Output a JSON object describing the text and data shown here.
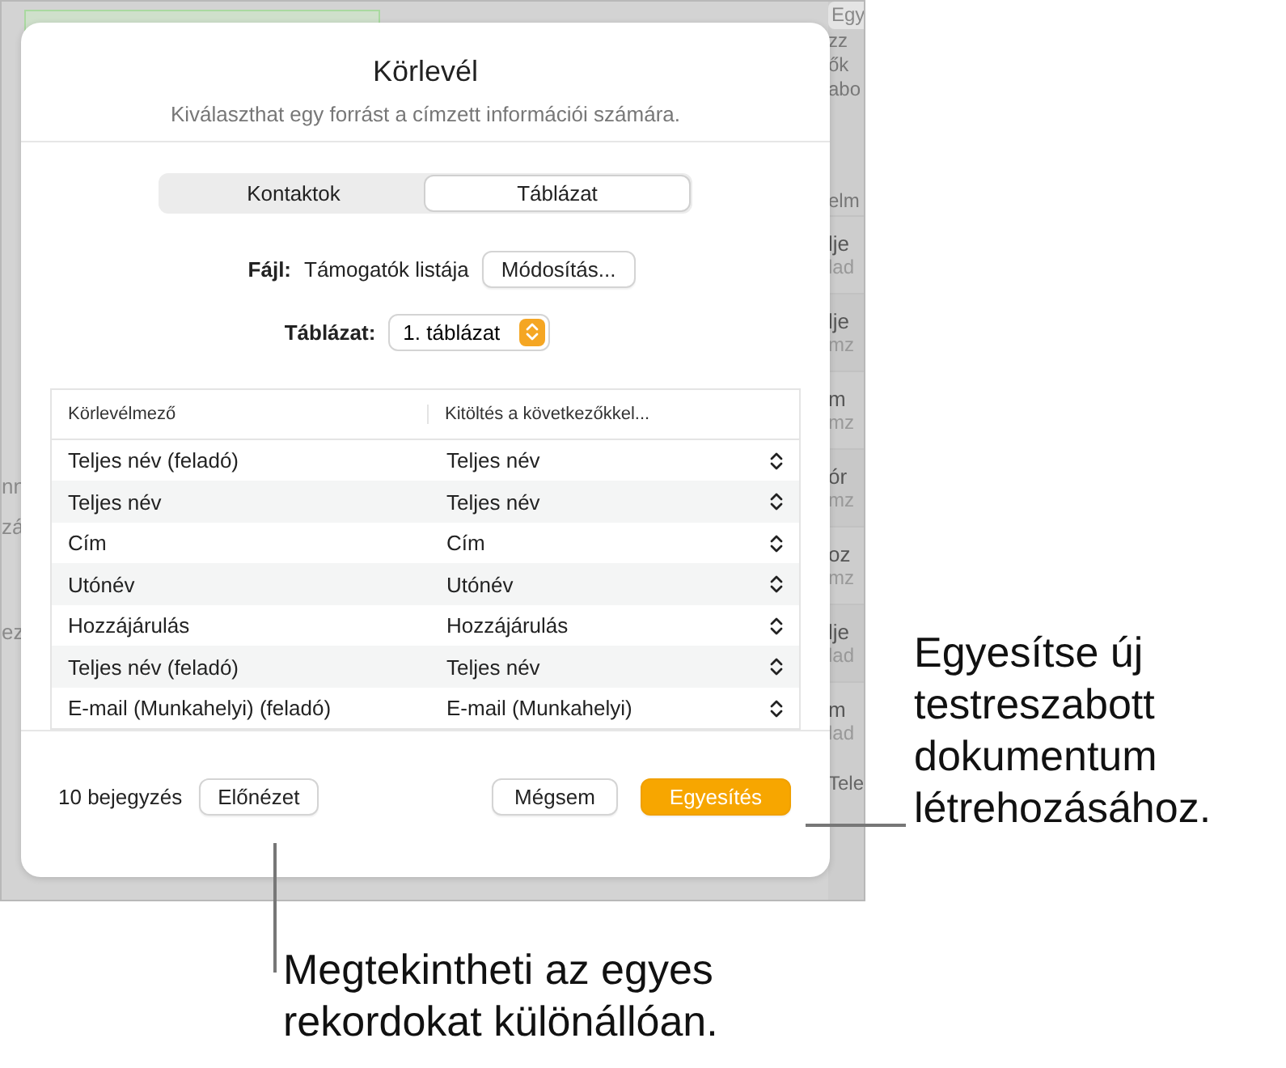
{
  "background": {
    "left_fragments": [
      "nn",
      "zá",
      "ez"
    ],
    "sidebar": {
      "field": "Egy",
      "lines": [
        "zz",
        "ők",
        "abo"
      ],
      "header": "elm",
      "rows": [
        {
          "title": "lje",
          "subtitle": "lad"
        },
        {
          "title": "lje",
          "subtitle": "mz"
        },
        {
          "title": "m",
          "subtitle": "mz"
        },
        {
          "title": "ór",
          "subtitle": "mz"
        },
        {
          "title": "oz",
          "subtitle": "mz"
        },
        {
          "title": "lje",
          "subtitle": "lad"
        },
        {
          "title": "m",
          "subtitle": "lad"
        }
      ],
      "footer": "Tele"
    }
  },
  "dialog": {
    "title": "Körlevél",
    "subtitle": "Kiválaszthat egy forrást a címzett információi számára.",
    "tabs": [
      {
        "label": "Kontaktok",
        "selected": false
      },
      {
        "label": "Táblázat",
        "selected": true
      }
    ],
    "file": {
      "label": "Fájl:",
      "value": "Támogatók listája",
      "button": "Módosítás..."
    },
    "table_select": {
      "label": "Táblázat:",
      "value": "1. táblázat"
    },
    "table": {
      "columns": [
        "Körlevélmező",
        "Kitöltés a következőkkel..."
      ],
      "rows": [
        {
          "field": "Teljes név (feladó)",
          "fill": "Teljes név"
        },
        {
          "field": "Teljes név",
          "fill": "Teljes név"
        },
        {
          "field": "Cím",
          "fill": "Cím"
        },
        {
          "field": "Utónév",
          "fill": "Utónév"
        },
        {
          "field": "Hozzájárulás",
          "fill": "Hozzájárulás"
        },
        {
          "field": "Teljes név (feladó)",
          "fill": "Teljes név"
        },
        {
          "field": "E-mail (Munkahelyi) (feladó)",
          "fill": "E-mail (Munkahelyi)"
        }
      ]
    },
    "footer": {
      "count": "10 bejegyzés",
      "preview": "Előnézet",
      "cancel": "Mégsem",
      "merge": "Egyesítés"
    }
  },
  "callouts": [
    {
      "kind": "right",
      "text": "Egyesítse új testreszabott dokumentum létrehozásához."
    },
    {
      "kind": "bottom",
      "text": "Megtekintheti az egyes rekordokat különállóan."
    }
  ]
}
